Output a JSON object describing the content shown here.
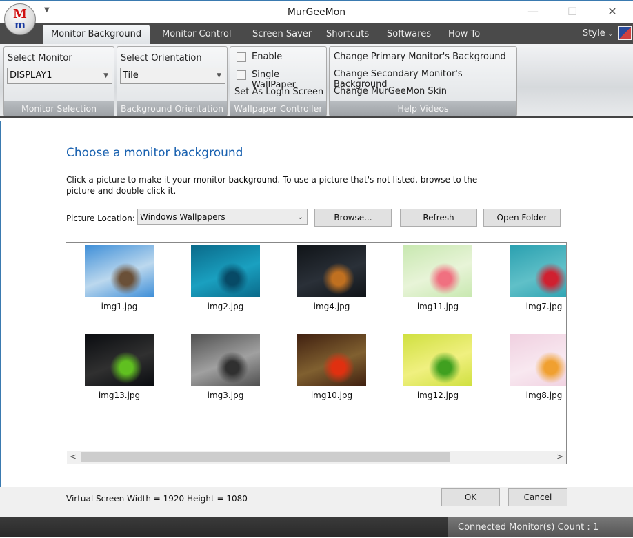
{
  "window": {
    "title": "MurGeeMon",
    "logo_text": "Mm",
    "quick_access_icon": "dropdown-arrow"
  },
  "tabs": [
    {
      "label": "Monitor Background",
      "active": true
    },
    {
      "label": "Monitor Control"
    },
    {
      "label": "Screen Saver"
    },
    {
      "label": "Shortcuts"
    },
    {
      "label": "Softwares"
    },
    {
      "label": "How To"
    }
  ],
  "style_menu": {
    "label": "Style"
  },
  "ribbon": {
    "monitor_selection": {
      "label": "Select Monitor",
      "value": "DISPLAY1",
      "group": "Monitor Selection"
    },
    "orientation": {
      "label": "Select Orientation",
      "value": "Tile",
      "group": "Background Orientation"
    },
    "wallpaper": {
      "enable": "Enable",
      "single": "Single WallPaper",
      "login": "Set As Login Screen",
      "group": "Wallpaper Controller",
      "enable_checked": false,
      "single_checked": false
    },
    "help": {
      "items": [
        "Change Primary Monitor's Background",
        "Change Secondary Monitor's Background",
        "Change MurGeeMon Skin"
      ],
      "group": "Help Videos"
    }
  },
  "main": {
    "heading": "Choose a monitor background",
    "description": "Click a picture to make it your monitor background. To use a picture that's not listed, browse to the picture and double click it.",
    "location_label": "Picture Location:",
    "location_value": "Windows Wallpapers",
    "browse": "Browse...",
    "refresh": "Refresh",
    "open_folder": "Open Folder",
    "images": [
      {
        "name": "img1.jpg",
        "colors": [
          "#3f8fd8",
          "#bcd8ee",
          "#6a5038"
        ]
      },
      {
        "name": "img2.jpg",
        "colors": [
          "#0a6a8a",
          "#1aa0c0",
          "#074a66"
        ]
      },
      {
        "name": "img4.jpg",
        "colors": [
          "#101418",
          "#2a3038",
          "#c07020"
        ]
      },
      {
        "name": "img11.jpg",
        "colors": [
          "#c8e8b0",
          "#e8f4d8",
          "#f07080"
        ]
      },
      {
        "name": "img7.jpg",
        "colors": [
          "#2aa0b0",
          "#60c0c8",
          "#d02030"
        ]
      },
      {
        "name": "img13.jpg",
        "colors": [
          "#0a0c10",
          "#303030",
          "#60c020"
        ]
      },
      {
        "name": "img3.jpg",
        "colors": [
          "#505050",
          "#a0a0a0",
          "#303030"
        ]
      },
      {
        "name": "img10.jpg",
        "colors": [
          "#402010",
          "#806030",
          "#e03010"
        ]
      },
      {
        "name": "img12.jpg",
        "colors": [
          "#d0e040",
          "#f0f080",
          "#40a020"
        ]
      },
      {
        "name": "img8.jpg",
        "colors": [
          "#f0d0e0",
          "#f8e8f0",
          "#f0a030"
        ]
      }
    ]
  },
  "footer": {
    "virtual_screen": "Virtual Screen Width = 1920 Height = 1080",
    "ok": "OK",
    "cancel": "Cancel"
  },
  "status": {
    "connected": "Connected Monitor(s) Count : 1"
  }
}
